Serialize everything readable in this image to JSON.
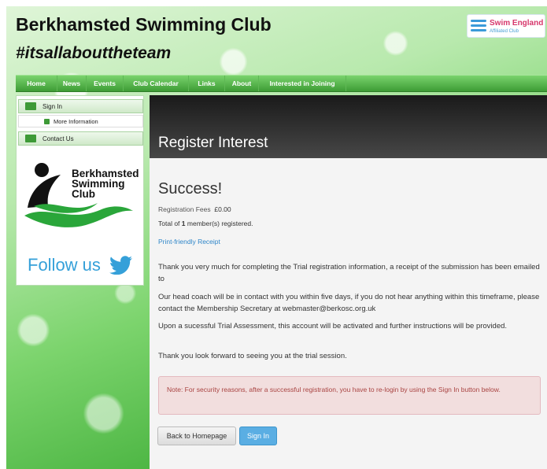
{
  "header": {
    "title": "Berkhamsted Swimming Club",
    "tagline": "#itsallabouttheteam",
    "badge": {
      "name": "Swim England",
      "sub": "Affiliated Club"
    }
  },
  "nav": {
    "items": [
      "Home",
      "News",
      "Events",
      "Club Calendar",
      "Links",
      "About",
      "Interested in Joining"
    ]
  },
  "sidebar": {
    "sign_in": "Sign In",
    "more_info": "More Information",
    "contact": "Contact Us",
    "logo_text": [
      "Berkhamsted",
      "Swimming",
      "Club"
    ],
    "follow": "Follow us"
  },
  "main": {
    "heading": "Register Interest",
    "success": "Success!",
    "fees_label": "Registration Fees",
    "fees_value": "£0.00",
    "total_prefix": "Total of",
    "total_count": "1",
    "total_suffix": "member(s) registered.",
    "receipt_link": "Print-friendly Receipt",
    "para1": "Thank you very much for completing the Trial registration information, a receipt of the submission has been emailed to",
    "para2": "Our head coach will be in contact with you within five days, if you do not hear anything within this timeframe, please contact the Membership Secretary at webmaster@berkosc.org.uk",
    "para3": "Upon a sucessful Trial Assessment, this account will be activated and further instructions will be provided.",
    "para4": "Thank you look forward to seeing you at the trial session.",
    "alert": "Note: For security reasons, after a successful registration, you have to re-login by using the Sign In button below.",
    "btn_home": "Back to Homepage",
    "btn_sign_in": "Sign In"
  },
  "colors": {
    "nav_green": "#4aad40",
    "link_blue": "#2f86c9",
    "alert_red": "#a94442",
    "twitter_blue": "#35a0d9"
  }
}
